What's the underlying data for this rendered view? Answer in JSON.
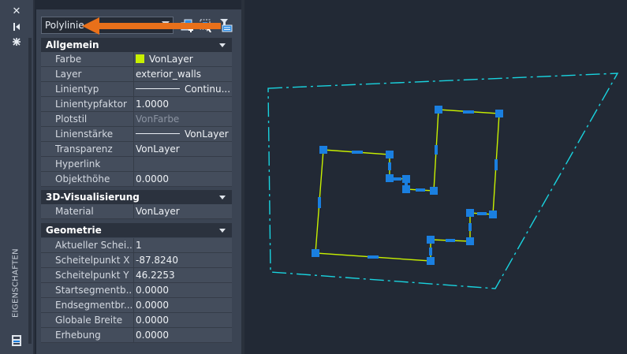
{
  "palette": {
    "title": "EIGENSCHAFTEN",
    "object_type": "Polylinie",
    "sections": [
      {
        "label": "Allgemein",
        "rows": [
          {
            "label": "Farbe",
            "value": "VonLayer"
          },
          {
            "label": "Layer",
            "value": "exterior_walls"
          },
          {
            "label": "Linientyp",
            "value": "Continu..."
          },
          {
            "label": "Linientypfaktor",
            "value": "1.0000"
          },
          {
            "label": "Plotstil",
            "value": "VonFarbe"
          },
          {
            "label": "Linienstärke",
            "value": "VonLayer"
          },
          {
            "label": "Transparenz",
            "value": "VonLayer"
          },
          {
            "label": "Hyperlink",
            "value": ""
          },
          {
            "label": "Objekthöhe",
            "value": "0.0000"
          }
        ]
      },
      {
        "label": "3D-Visualisierung",
        "rows": [
          {
            "label": "Material",
            "value": "VonLayer"
          }
        ]
      },
      {
        "label": "Geometrie",
        "rows": [
          {
            "label": "Aktueller Schei...",
            "value": "1"
          },
          {
            "label": "Scheitelpunkt X",
            "value": "-87.8240"
          },
          {
            "label": "Scheitelpunkt Y",
            "value": "46.2253"
          },
          {
            "label": "Startsegmentb...",
            "value": "0.0000"
          },
          {
            "label": "Endsegmentbr...",
            "value": "0.0000"
          },
          {
            "label": "Globale Breite",
            "value": "0.0000"
          },
          {
            "label": "Erhebung",
            "value": "0.0000"
          }
        ]
      }
    ]
  },
  "colors": {
    "layer_color": "#c8f000",
    "annotation_arrow": "#e8701a",
    "boundary": "#19d3df",
    "grip": "#1a7fe0"
  }
}
